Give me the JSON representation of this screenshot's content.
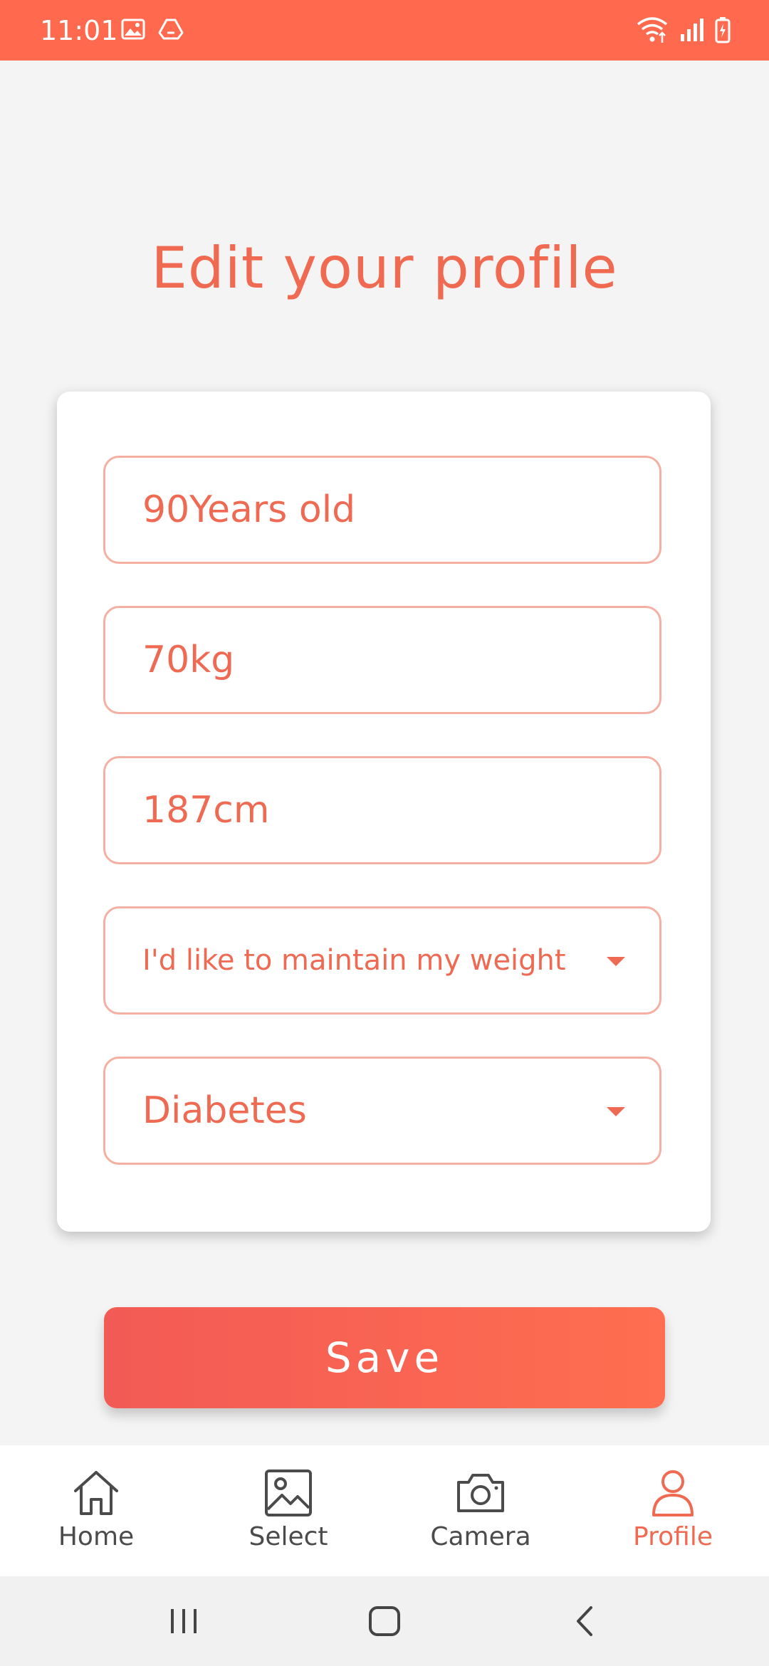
{
  "status_bar": {
    "time": "11:01",
    "left_icons": [
      "image-icon",
      "drive-icon"
    ],
    "right_icons": [
      "wifi-icon",
      "signal-icon",
      "battery-icon"
    ],
    "color": "#ff6a4f"
  },
  "page": {
    "title": "Edit your profile"
  },
  "form": {
    "age": "90Years old",
    "weight": "70kg",
    "height": "187cm",
    "goal": "I'd like to maintain my weight",
    "condition": "Diabetes"
  },
  "actions": {
    "save_label": "Save"
  },
  "bottom_nav": {
    "items": [
      {
        "label": "Home",
        "icon": "home-icon",
        "active": false
      },
      {
        "label": "Select",
        "icon": "image-icon",
        "active": false
      },
      {
        "label": "Camera",
        "icon": "camera-icon",
        "active": false
      },
      {
        "label": "Profile",
        "icon": "person-icon",
        "active": true
      }
    ]
  },
  "system_nav": {
    "buttons": [
      "recents-icon",
      "home-circle-icon",
      "back-icon"
    ]
  },
  "colors": {
    "accent": "#f06a52",
    "field_border": "#f4b0a3",
    "save_gradient_start": "#f25a55",
    "save_gradient_end": "#ff6e50"
  }
}
